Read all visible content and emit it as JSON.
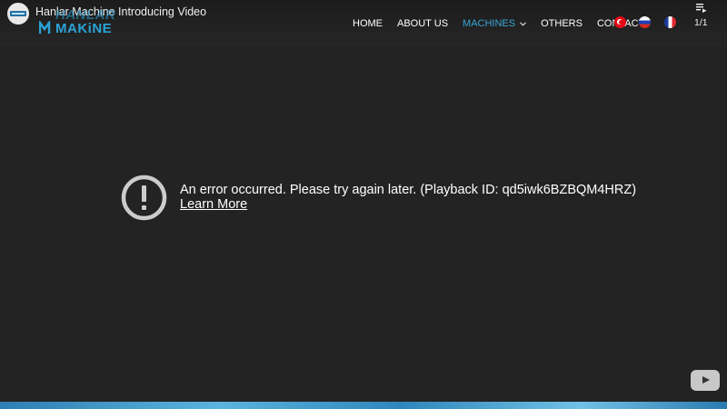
{
  "video": {
    "title": "Hanlar Machine Introducing Video",
    "playlist_position": "1/1"
  },
  "logo": {
    "line1": "HANLAR",
    "line2": "MAKiNE"
  },
  "nav": {
    "items": [
      {
        "label": "HOME",
        "active": false
      },
      {
        "label": "ABOUT US",
        "active": false
      },
      {
        "label": "MACHINES",
        "active": true
      },
      {
        "label": "OTHERS",
        "active": false
      },
      {
        "label": "CONTACT",
        "active": false
      }
    ],
    "languages": [
      "turkish-flag-icon",
      "russian-flag-icon",
      "french-flag-icon"
    ]
  },
  "error": {
    "message": "An error occurred. Please try again later. (Playback ID: qd5iwk6BZBQM4HRZ)",
    "link": "Learn More"
  },
  "colors": {
    "background": "#232323",
    "accent": "#3aa6d8",
    "logo": "#2aa3d8"
  }
}
